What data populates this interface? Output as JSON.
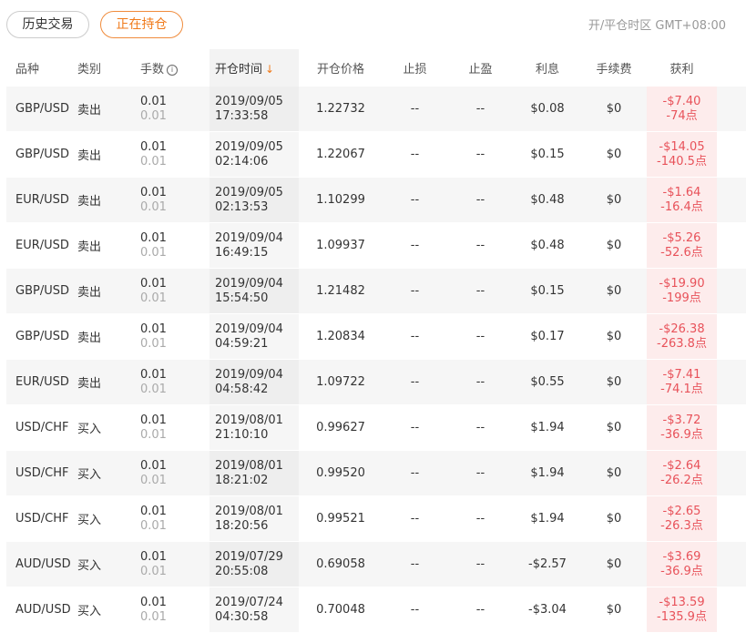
{
  "tabs": {
    "history": "历史交易",
    "open": "正在持仓"
  },
  "timezone": "开/平仓时区 GMT+08:00",
  "colors": {
    "accent": "#f07a1a",
    "loss": "#e8525a",
    "loss_bg": "#fdecec"
  },
  "columns": {
    "symbol": "品种",
    "type": "类别",
    "lots": "手数",
    "open_time": "开仓时间",
    "open_price": "开仓价格",
    "stop_loss": "止损",
    "take_profit": "止盈",
    "interest": "利息",
    "fee": "手续费",
    "pnl": "获利"
  },
  "icons": {
    "lots_info": "info-circle-icon",
    "sort": "sort-down-arrow-icon"
  },
  "rows": [
    {
      "symbol": "GBP/USD",
      "type": "卖出",
      "lots": "0.01",
      "lots_sub": "0.01",
      "date": "2019/09/05",
      "time": "17:33:58",
      "price": "1.22732",
      "sl": "--",
      "tp": "--",
      "interest": "$0.08",
      "fee": "$0",
      "pnl": "-$7.40",
      "points": "-74点"
    },
    {
      "symbol": "GBP/USD",
      "type": "卖出",
      "lots": "0.01",
      "lots_sub": "0.01",
      "date": "2019/09/05",
      "time": "02:14:06",
      "price": "1.22067",
      "sl": "--",
      "tp": "--",
      "interest": "$0.15",
      "fee": "$0",
      "pnl": "-$14.05",
      "points": "-140.5点"
    },
    {
      "symbol": "EUR/USD",
      "type": "卖出",
      "lots": "0.01",
      "lots_sub": "0.01",
      "date": "2019/09/05",
      "time": "02:13:53",
      "price": "1.10299",
      "sl": "--",
      "tp": "--",
      "interest": "$0.48",
      "fee": "$0",
      "pnl": "-$1.64",
      "points": "-16.4点"
    },
    {
      "symbol": "EUR/USD",
      "type": "卖出",
      "lots": "0.01",
      "lots_sub": "0.01",
      "date": "2019/09/04",
      "time": "16:49:15",
      "price": "1.09937",
      "sl": "--",
      "tp": "--",
      "interest": "$0.48",
      "fee": "$0",
      "pnl": "-$5.26",
      "points": "-52.6点"
    },
    {
      "symbol": "GBP/USD",
      "type": "卖出",
      "lots": "0.01",
      "lots_sub": "0.01",
      "date": "2019/09/04",
      "time": "15:54:50",
      "price": "1.21482",
      "sl": "--",
      "tp": "--",
      "interest": "$0.15",
      "fee": "$0",
      "pnl": "-$19.90",
      "points": "-199点"
    },
    {
      "symbol": "GBP/USD",
      "type": "卖出",
      "lots": "0.01",
      "lots_sub": "0.01",
      "date": "2019/09/04",
      "time": "04:59:21",
      "price": "1.20834",
      "sl": "--",
      "tp": "--",
      "interest": "$0.17",
      "fee": "$0",
      "pnl": "-$26.38",
      "points": "-263.8点"
    },
    {
      "symbol": "EUR/USD",
      "type": "卖出",
      "lots": "0.01",
      "lots_sub": "0.01",
      "date": "2019/09/04",
      "time": "04:58:42",
      "price": "1.09722",
      "sl": "--",
      "tp": "--",
      "interest": "$0.55",
      "fee": "$0",
      "pnl": "-$7.41",
      "points": "-74.1点"
    },
    {
      "symbol": "USD/CHF",
      "type": "买入",
      "lots": "0.01",
      "lots_sub": "0.01",
      "date": "2019/08/01",
      "time": "21:10:10",
      "price": "0.99627",
      "sl": "--",
      "tp": "--",
      "interest": "$1.94",
      "fee": "$0",
      "pnl": "-$3.72",
      "points": "-36.9点"
    },
    {
      "symbol": "USD/CHF",
      "type": "买入",
      "lots": "0.01",
      "lots_sub": "0.01",
      "date": "2019/08/01",
      "time": "18:21:02",
      "price": "0.99520",
      "sl": "--",
      "tp": "--",
      "interest": "$1.94",
      "fee": "$0",
      "pnl": "-$2.64",
      "points": "-26.2点"
    },
    {
      "symbol": "USD/CHF",
      "type": "买入",
      "lots": "0.01",
      "lots_sub": "0.01",
      "date": "2019/08/01",
      "time": "18:20:56",
      "price": "0.99521",
      "sl": "--",
      "tp": "--",
      "interest": "$1.94",
      "fee": "$0",
      "pnl": "-$2.65",
      "points": "-26.3点"
    },
    {
      "symbol": "AUD/USD",
      "type": "买入",
      "lots": "0.01",
      "lots_sub": "0.01",
      "date": "2019/07/29",
      "time": "20:55:08",
      "price": "0.69058",
      "sl": "--",
      "tp": "--",
      "interest": "-$2.57",
      "fee": "$0",
      "pnl": "-$3.69",
      "points": "-36.9点"
    },
    {
      "symbol": "AUD/USD",
      "type": "买入",
      "lots": "0.01",
      "lots_sub": "0.01",
      "date": "2019/07/24",
      "time": "04:30:58",
      "price": "0.70048",
      "sl": "--",
      "tp": "--",
      "interest": "-$3.04",
      "fee": "$0",
      "pnl": "-$13.59",
      "points": "-135.9点"
    }
  ]
}
